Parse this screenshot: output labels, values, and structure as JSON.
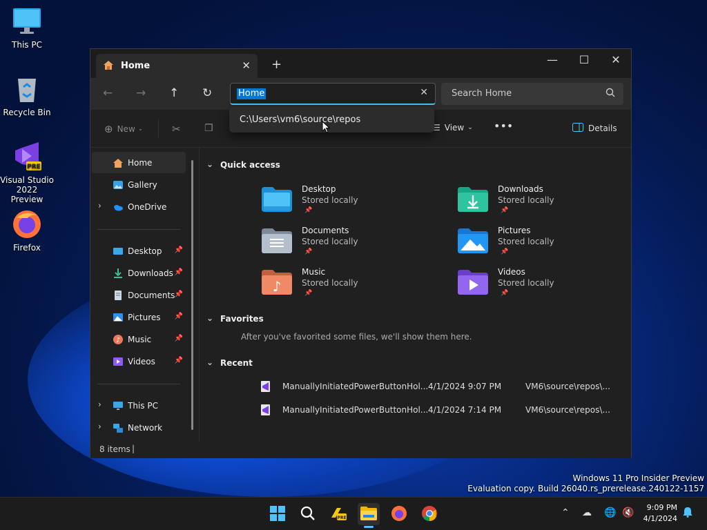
{
  "desktop": {
    "icons": [
      {
        "label": "This PC"
      },
      {
        "label": "Recycle Bin"
      },
      {
        "label": "Visual Studio 2022 Preview"
      },
      {
        "label": "Firefox"
      }
    ]
  },
  "window": {
    "tab_title": "Home",
    "address_value": "Home",
    "address_suggestion": "C:\\Users\\vm6\\source\\repos",
    "search_placeholder": "Search Home",
    "toolbar": {
      "new_label": "New",
      "view_label": "View",
      "details_label": "Details"
    },
    "sidebar": {
      "items": [
        {
          "label": "Home",
          "selected": true
        },
        {
          "label": "Gallery"
        },
        {
          "label": "OneDrive"
        },
        {
          "label": "Desktop",
          "pinned": true
        },
        {
          "label": "Downloads",
          "pinned": true
        },
        {
          "label": "Documents",
          "pinned": true
        },
        {
          "label": "Pictures",
          "pinned": true
        },
        {
          "label": "Music",
          "pinned": true
        },
        {
          "label": "Videos",
          "pinned": true
        },
        {
          "label": "This PC"
        },
        {
          "label": "Network"
        }
      ]
    },
    "main": {
      "quick_access_title": "Quick access",
      "quick_access": [
        {
          "name": "Desktop",
          "sub": "Stored locally"
        },
        {
          "name": "Downloads",
          "sub": "Stored locally"
        },
        {
          "name": "Documents",
          "sub": "Stored locally"
        },
        {
          "name": "Pictures",
          "sub": "Stored locally"
        },
        {
          "name": "Music",
          "sub": "Stored locally"
        },
        {
          "name": "Videos",
          "sub": "Stored locally"
        }
      ],
      "favorites_title": "Favorites",
      "favorites_hint": "After you've favorited some files, we'll show them here.",
      "recent_title": "Recent",
      "recent": [
        {
          "name": "ManuallyInitiatedPowerButtonHol...",
          "date": "4/1/2024 9:07 PM",
          "location": "VM6\\source\\repos\\..."
        },
        {
          "name": "ManuallyInitiatedPowerButtonHol...",
          "date": "4/1/2024 7:14 PM",
          "location": "VM6\\source\\repos\\..."
        }
      ]
    },
    "status": "8 items"
  },
  "watermark": {
    "line1": "Windows 11 Pro Insider Preview",
    "line2": "Evaluation copy. Build 26040.rs_prerelease.240122-1157"
  },
  "taskbar": {
    "time": "9:09 PM",
    "date": "4/1/2024"
  },
  "colors": {
    "accent": "#4cc2ff",
    "selection": "#0078d4"
  }
}
